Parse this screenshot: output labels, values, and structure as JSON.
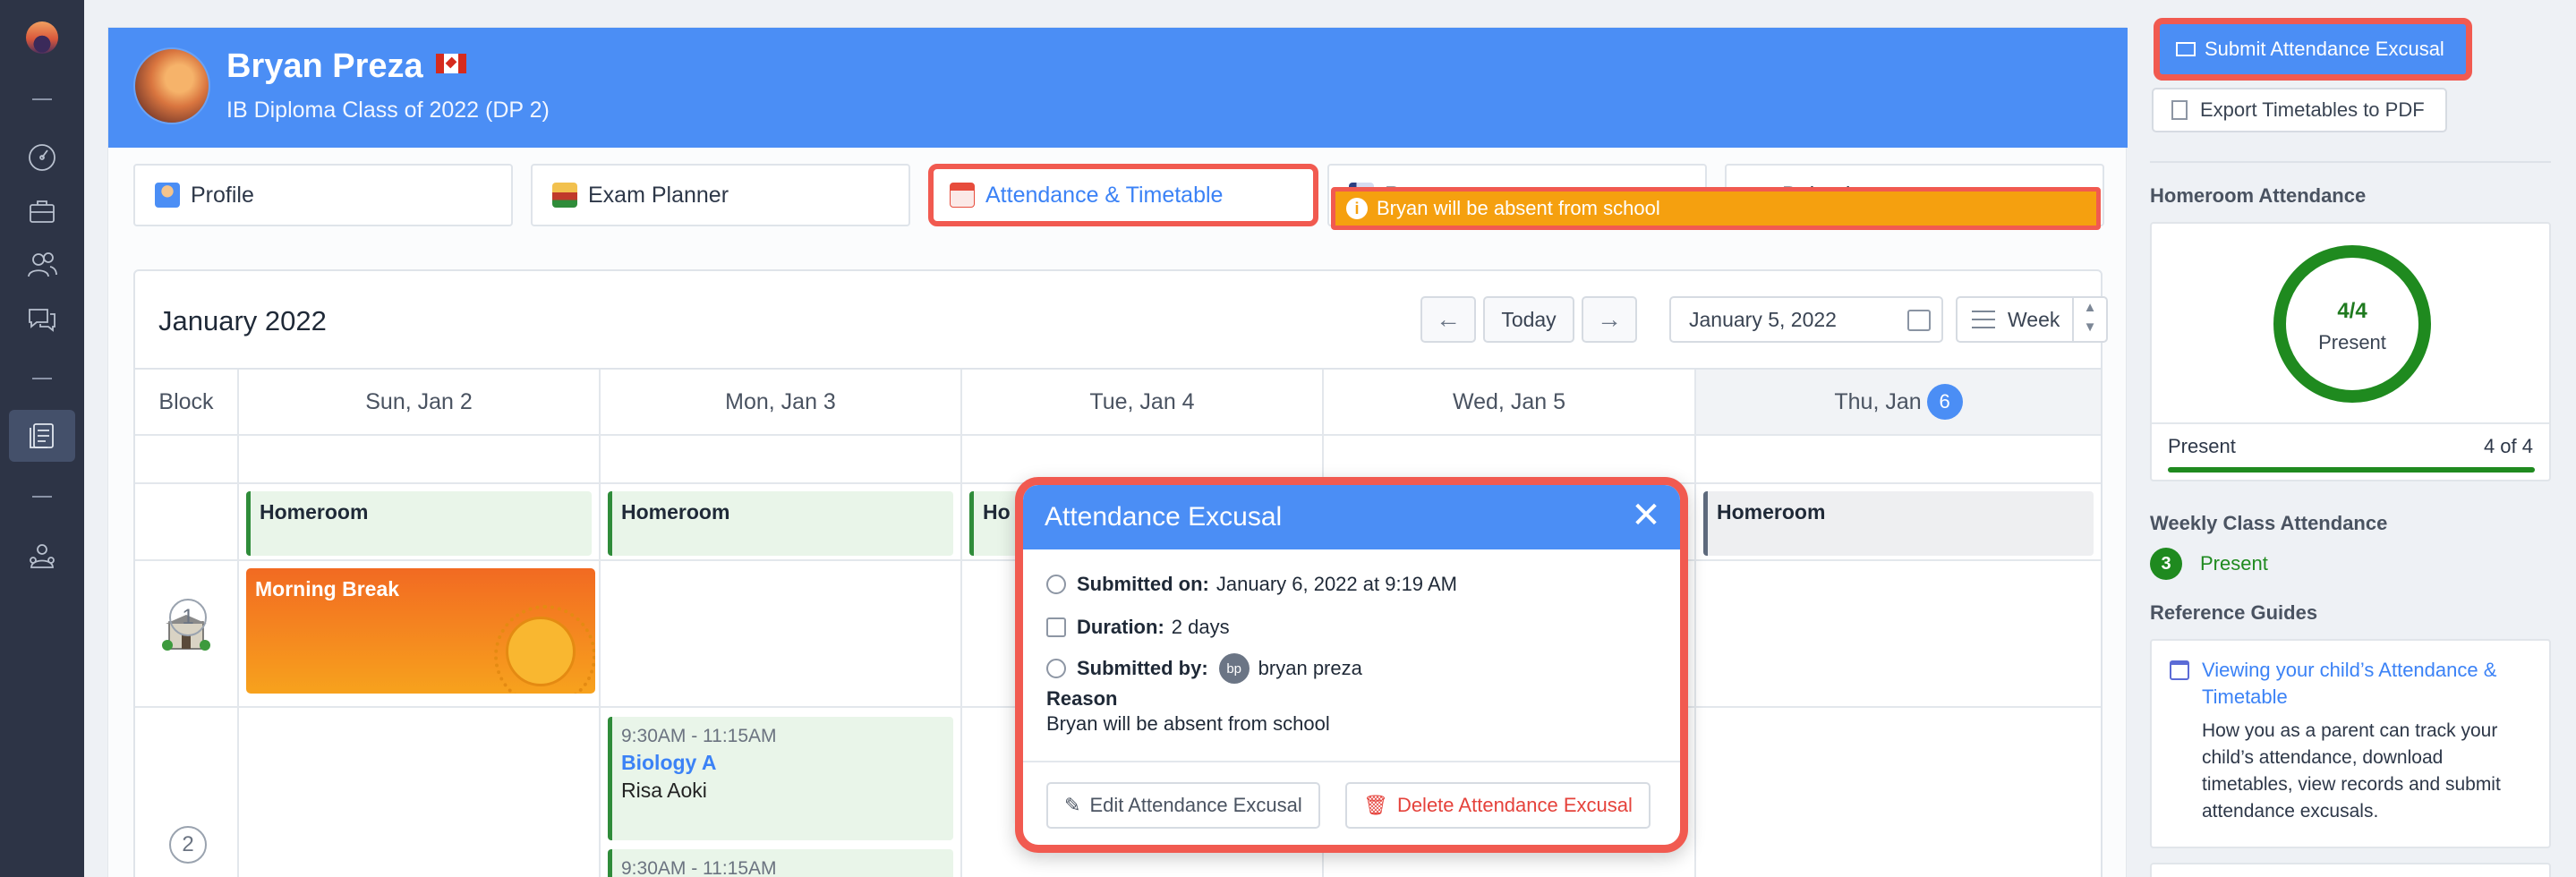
{
  "student": {
    "name": "Bryan Preza",
    "class": "IB Diploma Class of 2022 (DP 2)"
  },
  "tabs": [
    {
      "label": "Profile",
      "icon": "profile-icon",
      "color": "#4b8ef5"
    },
    {
      "label": "Exam Planner",
      "icon": "exam-planner-icon",
      "color": "#c0392b"
    },
    {
      "label": "Attendance & Timetable",
      "icon": "calendar-icon",
      "color": "#e74c3c",
      "active": true
    },
    {
      "label": "Reports",
      "icon": "report-icon",
      "color": "#2c3e80"
    },
    {
      "label": "Behaviour",
      "icon": "behaviour-icon",
      "color": "#3b82f6"
    }
  ],
  "calendar": {
    "month": "January 2022",
    "prev_icon": "←",
    "next_icon": "→",
    "today_label": "Today",
    "date_value": "January 5, 2022",
    "view_label": "Week",
    "block_header": "Block",
    "days": [
      {
        "label": "Sun, Jan 2"
      },
      {
        "label": "Mon, Jan 3"
      },
      {
        "label": "Tue, Jan 4"
      },
      {
        "label": "Wed, Jan 5"
      },
      {
        "label": "Thu, Jan",
        "badge": "6"
      }
    ],
    "absent_banner": "Bryan will be absent from school",
    "homeroom": [
      "Homeroom",
      "Homeroom",
      "Ho",
      "Homeroom"
    ],
    "morning_break": "Morning Break",
    "blocks": [
      "1",
      "2"
    ],
    "events": [
      {
        "time": "9:30AM - 11:15AM",
        "course": "Biology A",
        "teacher": "Risa Aoki"
      },
      {
        "time": "9:30AM - 11:15AM"
      }
    ]
  },
  "popup": {
    "title": "Attendance Excusal",
    "close": "✕",
    "submitted_on_label": "Submitted on:",
    "submitted_on": "January 6, 2022 at 9:19 AM",
    "duration_label": "Duration:",
    "duration": "2 days",
    "submitted_by_label": "Submitted by:",
    "submitted_by_initials": "bp",
    "submitted_by": "bryan preza",
    "reason_label": "Reason",
    "reason": "Bryan will be absent from school",
    "edit_label": "Edit Attendance Excusal",
    "delete_label": "Delete Attendance Excusal"
  },
  "sidebar": {
    "submit_label": "Submit Attendance Excusal",
    "export_label": "Export Timetables to PDF",
    "homeroom_heading": "Homeroom Attendance",
    "ring_value": "4/4",
    "ring_label": "Present",
    "present_label": "Present",
    "present_count": "4 of 4",
    "present_fraction": 1.0,
    "weekly_heading": "Weekly Class Attendance",
    "weekly_count": "3",
    "weekly_label": "Present",
    "guides_heading": "Reference Guides",
    "guide_title": "Viewing your child’s Attendance & Timetable",
    "guide_desc": "How you as a parent can track your child’s attendance, download timetables, view records and submit attendance excusals."
  },
  "colors": {
    "accent": "#4b8ef5",
    "highlight": "#f15a50",
    "present_green": "#1f8a1f",
    "absent_orange": "#f5a00f"
  }
}
